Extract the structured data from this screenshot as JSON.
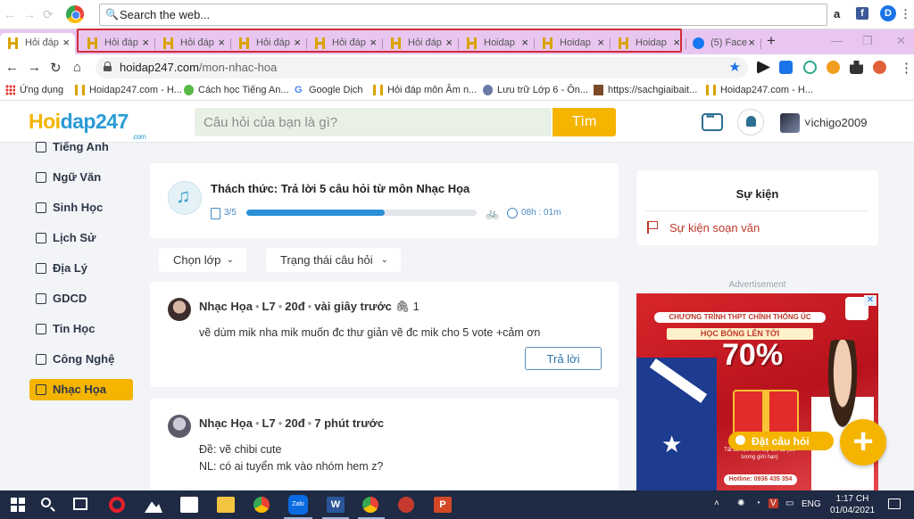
{
  "browser": {
    "web_search_text": "Search the web...",
    "tabs": [
      {
        "label": "Hỏi đáp",
        "active": true
      },
      {
        "label": "Hỏi đáp"
      },
      {
        "label": "Hỏi đáp"
      },
      {
        "label": "Hỏi đáp"
      },
      {
        "label": "Hỏi đáp"
      },
      {
        "label": "Hỏi đáp"
      },
      {
        "label": "Hoidap"
      },
      {
        "label": "Hoidap"
      },
      {
        "label": "Hoidap"
      },
      {
        "label": "(5) Face"
      }
    ],
    "close_glyph": "×",
    "new_tab_glyph": "+",
    "url_host": "hoidap247.com",
    "url_path": "/mon-nhac-hoa",
    "bookmarks": [
      {
        "label": "Ứng dụng",
        "icon": "apps-icon"
      },
      {
        "label": "Hoidap247.com - H...",
        "icon": "hoidap-icon"
      },
      {
        "label": "Cách học Tiếng An...",
        "icon": "green-icon"
      },
      {
        "label": "Google Dịch",
        "icon": "google-translate-icon"
      },
      {
        "label": "Hỏi đáp môn Âm n...",
        "icon": "hoidap-icon"
      },
      {
        "label": "Lưu trữ Lớp 6 - Ôn...",
        "icon": "avatar-icon"
      },
      {
        "label": "https://sachgiaibait...",
        "icon": "photo-icon"
      },
      {
        "label": "Hoidap247.com - H...",
        "icon": "hoidap-icon"
      }
    ]
  },
  "site": {
    "logo_a": "Hoi",
    "logo_b": "dap247",
    "logo_com": ".com",
    "search_placeholder": "Câu hỏi của bạn là gì?",
    "search_button": "Tìm",
    "username": "ichigo2009",
    "user_caret": "˅"
  },
  "sidebar": {
    "items": [
      {
        "label": "Tiếng Anh",
        "icon": "english-icon"
      },
      {
        "label": "Ngữ Văn",
        "icon": "literature-icon"
      },
      {
        "label": "Sinh Học",
        "icon": "biology-icon"
      },
      {
        "label": "Lịch Sử",
        "icon": "history-icon"
      },
      {
        "label": "Địa Lý",
        "icon": "geography-icon"
      },
      {
        "label": "GDCD",
        "icon": "civics-icon"
      },
      {
        "label": "Tin Học",
        "icon": "informatics-icon"
      },
      {
        "label": "Công Nghệ",
        "icon": "technology-icon"
      },
      {
        "label": "Nhạc Họa",
        "icon": "music-icon",
        "active": true
      }
    ]
  },
  "challenge": {
    "title": "Thách thức: Trả lời 5 câu hỏi  từ môn Nhạc Họa",
    "count": "3/5",
    "progress": 0.6,
    "timer": "08h : 01m"
  },
  "filters": {
    "class_label": "Chọn lớp",
    "status_label": "Trạng thái câu hỏi",
    "chevron": "⌄"
  },
  "questions": [
    {
      "subject": "Nhạc Họa",
      "grade": "L7",
      "points": "20đ",
      "time": "vài giây trước",
      "attachments": "🖇 1",
      "lines": [
        "vẽ dùm mik nha mik muốn đc thư giản vẽ đc mik cho 5 vote +cảm ơn"
      ],
      "reply_label": "Trả lời"
    },
    {
      "subject": "Nhạc Họa",
      "grade": "L7",
      "points": "20đ",
      "time": "7 phút trước",
      "lines": [
        "Đề: vẽ chibi cute",
        "NL: có ai tuyển mk vào nhóm hem z?"
      ]
    }
  ],
  "events": {
    "title": "Sự kiện",
    "item": "Sự kiện soạn văn"
  },
  "ad": {
    "label": "Advertisement",
    "line1": "CHƯƠNG TRÌNH THPT CHÍNH THỐNG ÚC",
    "line2": "HỌC BỔNG LÊN TỚI",
    "percent": "70%",
    "small": "Tất cả học sinh lớp 10, 11 (Số lượng giới hạn)",
    "hotline": "Hotline: 0936 435 354",
    "close": "✕"
  },
  "actions": {
    "ask_label": "Đặt câu hỏi",
    "plus": "+"
  },
  "taskbar": {
    "lang": "ENG",
    "time": "1:17 CH",
    "date": "01/04/2021"
  }
}
